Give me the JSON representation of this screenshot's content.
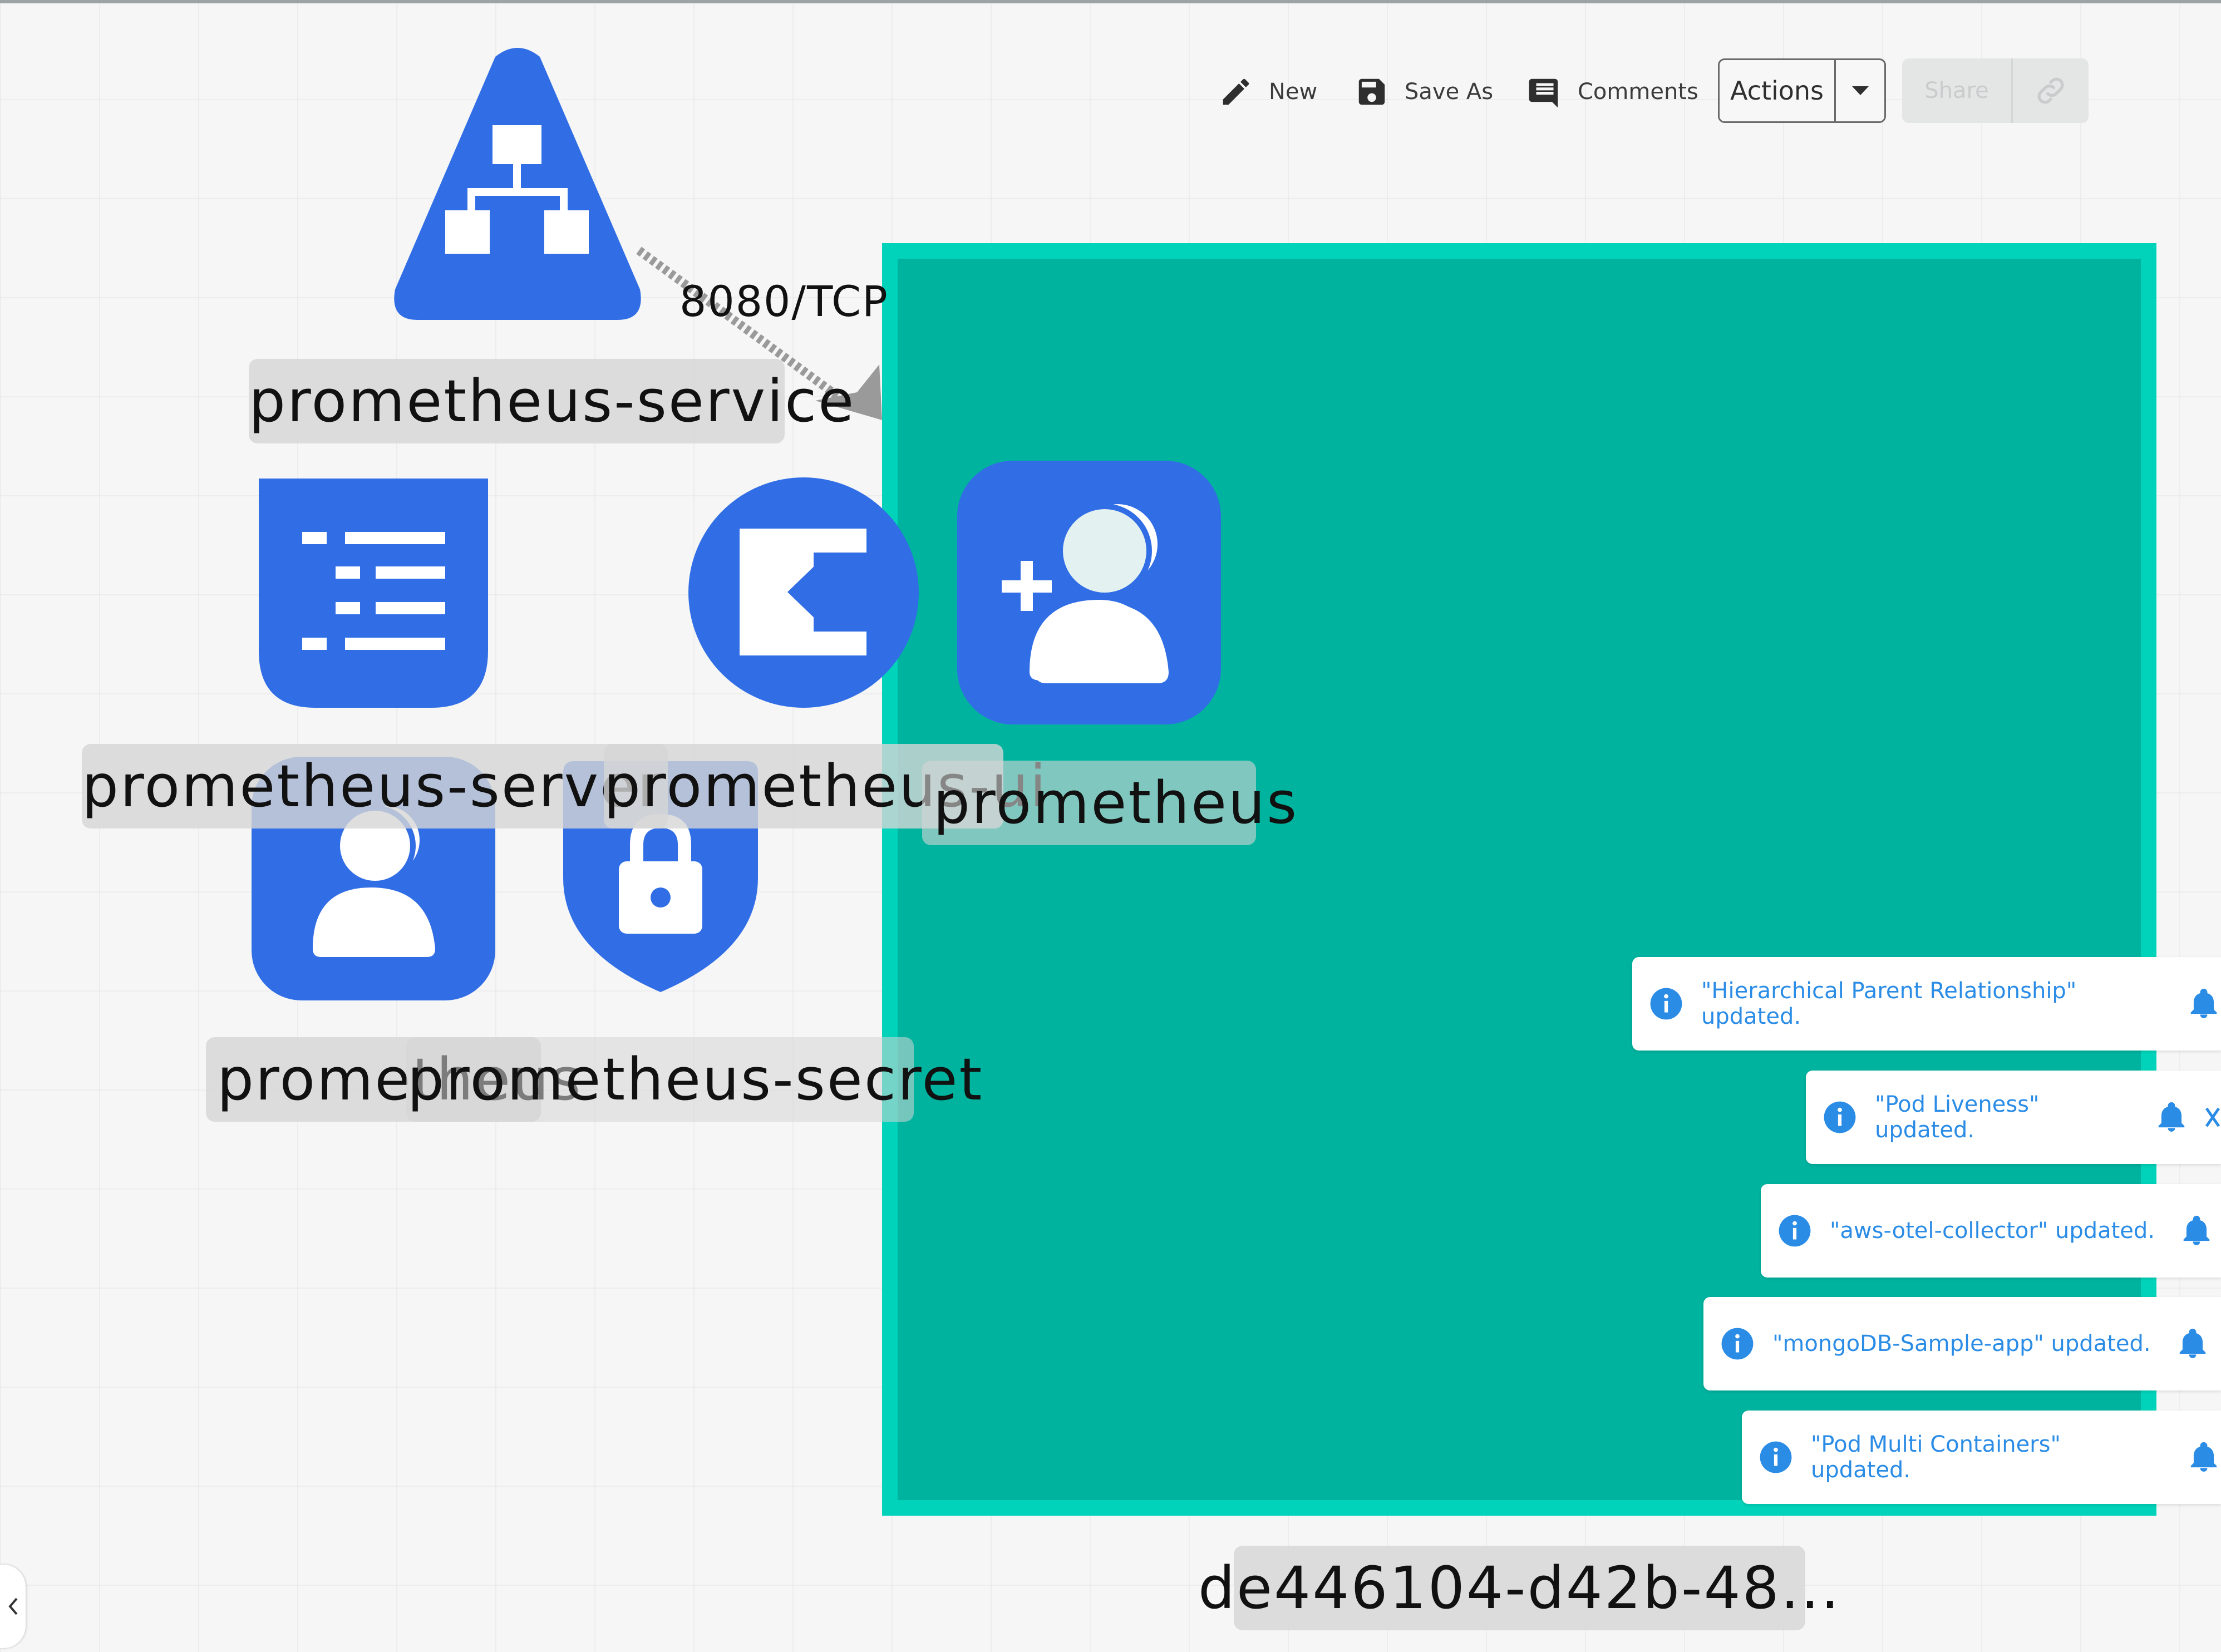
{
  "toolbar": {
    "new_label": "New",
    "save_as_label": "Save As",
    "comments_label": "Comments",
    "actions_label": "Actions",
    "share_label": "Share"
  },
  "diagram": {
    "service_label": "prometheus-service",
    "edge_label": "8080/TCP",
    "server_label": "prometheus-server",
    "ui_label": "prometheus-ui",
    "account_label": "prometheus",
    "role_label": "prometheus",
    "secret_label": "prometheus-secret",
    "container_label": "de446104-d42b-48..."
  },
  "notifications": [
    {
      "text": "\"Hierarchical Parent Relationship\" updated."
    },
    {
      "text": "\"Pod Liveness\" updated."
    },
    {
      "text": "\"aws-otel-collector\" updated."
    },
    {
      "text": "\"mongoDB-Sample-app\" updated."
    },
    {
      "text": "\"Pod Multi Containers\" updated."
    }
  ],
  "colors": {
    "node_blue": "#316ee6",
    "container_fill": "#00b39f",
    "container_border": "#00d3b9",
    "info_blue": "#2b8ce6"
  },
  "icons": [
    "pencil-icon",
    "save-icon",
    "comment-icon",
    "caret-down-icon",
    "link-icon",
    "hierarchy-icon",
    "list-icon",
    "login-icon",
    "add-user-icon",
    "user-icon",
    "lock-shield-icon",
    "info-icon",
    "bell-icon",
    "chevron-left-icon"
  ]
}
